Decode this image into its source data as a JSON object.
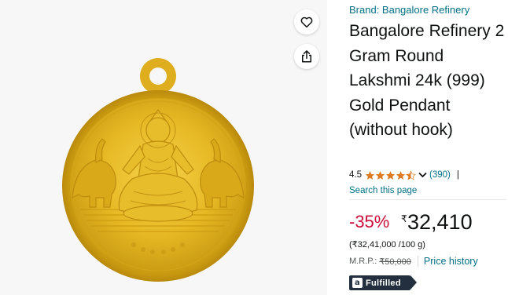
{
  "product": {
    "brand": "Brand: Bangalore Refinery",
    "title": "Bangalore Refinery 2 Gram Round Lakshmi 24k (999) Gold Pendant (without hook)",
    "image_icons": {
      "wishlist": "heart-icon",
      "share": "share-icon"
    }
  },
  "rating": {
    "value": "4.5",
    "stars": 4.5,
    "count": "(390)",
    "separator": "|",
    "search_link": "Search this page"
  },
  "pricing": {
    "discount": "-35%",
    "currency_symbol": "₹",
    "price": "32,410",
    "unit_price": "(₹32,41,000 /100 g)",
    "mrp_label": "M.R.P.:",
    "mrp_value": "₹50,000",
    "price_history": "Price history"
  },
  "badge": {
    "fulfilled": "Fulfilled"
  },
  "colors": {
    "link": "#007185",
    "discount": "#cc0c39",
    "star": "#de7921",
    "badge_bg": "#232f3e",
    "gold": "#e0b421"
  }
}
